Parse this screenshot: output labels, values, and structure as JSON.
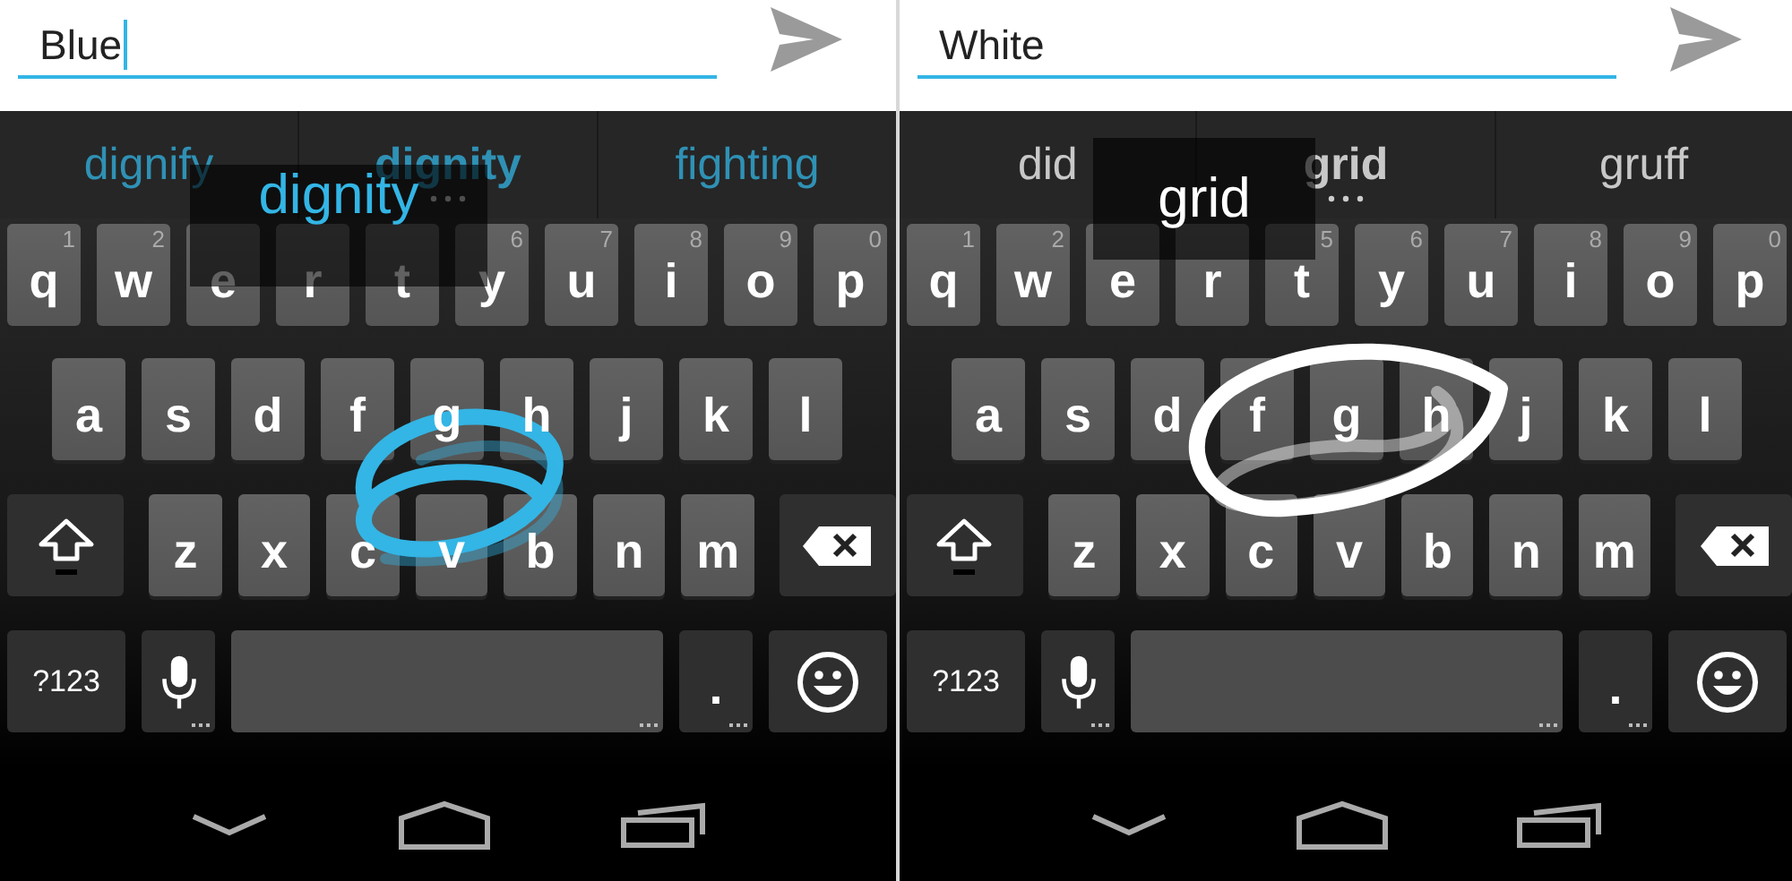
{
  "panels": [
    {
      "color": "#33b5e5",
      "input": {
        "value": "Blue",
        "focused": true
      },
      "suggestions": [
        {
          "text": "dignify",
          "selected": false
        },
        {
          "text": "dignity",
          "selected": true
        },
        {
          "text": "fighting",
          "selected": false
        }
      ],
      "preview": "dignity",
      "rows": [
        {
          "keys": [
            {
              "kind": "letter",
              "label": "q",
              "hint": "1"
            },
            {
              "kind": "letter",
              "label": "w",
              "hint": "2"
            },
            {
              "kind": "letter",
              "label": "e"
            },
            {
              "kind": "letter",
              "label": "r"
            },
            {
              "kind": "letter",
              "label": "t"
            },
            {
              "kind": "letter",
              "label": "y",
              "hint": "6"
            },
            {
              "kind": "letter",
              "label": "u",
              "hint": "7"
            },
            {
              "kind": "letter",
              "label": "i",
              "hint": "8"
            },
            {
              "kind": "letter",
              "label": "o",
              "hint": "9"
            },
            {
              "kind": "letter",
              "label": "p",
              "hint": "0"
            }
          ]
        },
        {
          "keys": [
            {
              "kind": "letter",
              "label": "a"
            },
            {
              "kind": "letter",
              "label": "s"
            },
            {
              "kind": "letter",
              "label": "d"
            },
            {
              "kind": "letter",
              "label": "f"
            },
            {
              "kind": "letter",
              "label": "g"
            },
            {
              "kind": "letter",
              "label": "h"
            },
            {
              "kind": "letter",
              "label": "j"
            },
            {
              "kind": "letter",
              "label": "k"
            },
            {
              "kind": "letter",
              "label": "l"
            }
          ]
        },
        {
          "keys": [
            {
              "kind": "shift"
            },
            {
              "kind": "letter",
              "label": "z"
            },
            {
              "kind": "letter",
              "label": "x"
            },
            {
              "kind": "letter",
              "label": "c"
            },
            {
              "kind": "letter",
              "label": "v"
            },
            {
              "kind": "letter",
              "label": "b"
            },
            {
              "kind": "letter",
              "label": "n"
            },
            {
              "kind": "letter",
              "label": "m"
            },
            {
              "kind": "backspace"
            }
          ]
        },
        {
          "keys": [
            {
              "kind": "symbols",
              "label": "?123"
            },
            {
              "kind": "mic"
            },
            {
              "kind": "space"
            },
            {
              "kind": "period",
              "label": "."
            },
            {
              "kind": "emoji"
            }
          ]
        }
      ]
    },
    {
      "color": "#ffffff",
      "input": {
        "value": "White",
        "focused": false
      },
      "suggestions": [
        {
          "text": "did",
          "selected": false
        },
        {
          "text": "grid",
          "selected": true
        },
        {
          "text": "gruff",
          "selected": false
        }
      ],
      "preview": "grid",
      "rows": [
        {
          "keys": [
            {
              "kind": "letter",
              "label": "q",
              "hint": "1"
            },
            {
              "kind": "letter",
              "label": "w",
              "hint": "2"
            },
            {
              "kind": "letter",
              "label": "e"
            },
            {
              "kind": "letter",
              "label": "r"
            },
            {
              "kind": "letter",
              "label": "t",
              "hint": "5"
            },
            {
              "kind": "letter",
              "label": "y",
              "hint": "6"
            },
            {
              "kind": "letter",
              "label": "u",
              "hint": "7"
            },
            {
              "kind": "letter",
              "label": "i",
              "hint": "8"
            },
            {
              "kind": "letter",
              "label": "o",
              "hint": "9"
            },
            {
              "kind": "letter",
              "label": "p",
              "hint": "0"
            }
          ]
        },
        {
          "keys": [
            {
              "kind": "letter",
              "label": "a"
            },
            {
              "kind": "letter",
              "label": "s"
            },
            {
              "kind": "letter",
              "label": "d"
            },
            {
              "kind": "letter",
              "label": "f"
            },
            {
              "kind": "letter",
              "label": "g"
            },
            {
              "kind": "letter",
              "label": "h"
            },
            {
              "kind": "letter",
              "label": "j"
            },
            {
              "kind": "letter",
              "label": "k"
            },
            {
              "kind": "letter",
              "label": "l"
            }
          ]
        },
        {
          "keys": [
            {
              "kind": "shift"
            },
            {
              "kind": "letter",
              "label": "z"
            },
            {
              "kind": "letter",
              "label": "x"
            },
            {
              "kind": "letter",
              "label": "c"
            },
            {
              "kind": "letter",
              "label": "v"
            },
            {
              "kind": "letter",
              "label": "b"
            },
            {
              "kind": "letter",
              "label": "n"
            },
            {
              "kind": "letter",
              "label": "m"
            },
            {
              "kind": "backspace"
            }
          ]
        },
        {
          "keys": [
            {
              "kind": "symbols",
              "label": "?123"
            },
            {
              "kind": "mic"
            },
            {
              "kind": "space"
            },
            {
              "kind": "period",
              "label": "."
            },
            {
              "kind": "emoji"
            }
          ]
        }
      ]
    }
  ]
}
